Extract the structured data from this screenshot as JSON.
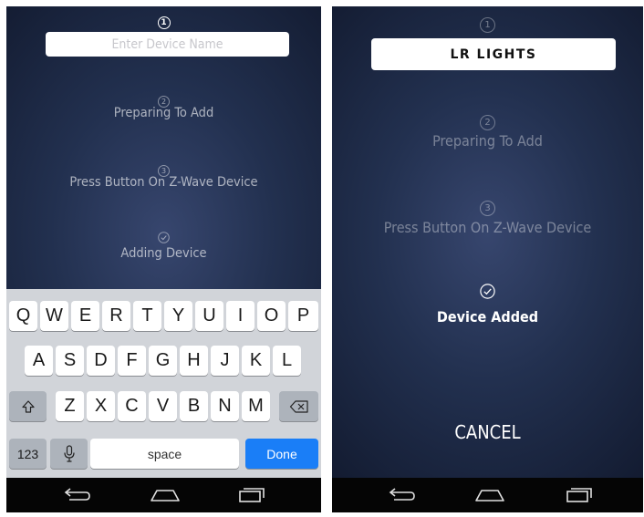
{
  "left_screen": {
    "step1_number": "1",
    "device_name_placeholder": "Enter Device Name",
    "steps": [
      {
        "number": "2",
        "label": "Preparing To Add"
      },
      {
        "number": "3",
        "label": "Press Button On Z-Wave Device"
      },
      {
        "label": "Adding Device"
      }
    ],
    "keyboard": {
      "row1": [
        "Q",
        "W",
        "E",
        "R",
        "T",
        "Y",
        "U",
        "I",
        "O",
        "P"
      ],
      "row2": [
        "A",
        "S",
        "D",
        "F",
        "G",
        "H",
        "J",
        "K",
        "L"
      ],
      "row3": [
        "Z",
        "X",
        "C",
        "V",
        "B",
        "N",
        "M"
      ],
      "numbers_label": "123",
      "space_label": "space",
      "done_label": "Done",
      "shift_icon": "shift-icon",
      "delete_icon": "backspace-icon",
      "mic_icon": "microphone-icon"
    }
  },
  "right_screen": {
    "step1_number": "1",
    "device_name": "LR LIGHTS",
    "steps": [
      {
        "number": "2",
        "label": "Preparing To Add"
      },
      {
        "number": "3",
        "label": "Press Button On Z-Wave Device"
      },
      {
        "label": "Device Added"
      }
    ],
    "cancel_label": "CANCEL"
  },
  "navbar": {
    "icons": [
      "back-icon",
      "home-icon",
      "recent-apps-icon"
    ]
  },
  "colors": {
    "background_center": "#37466e",
    "background_edge": "#121a2f",
    "keyboard_bg": "#d1d4d9",
    "done_key": "#1a7ef7",
    "navbar": "#050505"
  }
}
